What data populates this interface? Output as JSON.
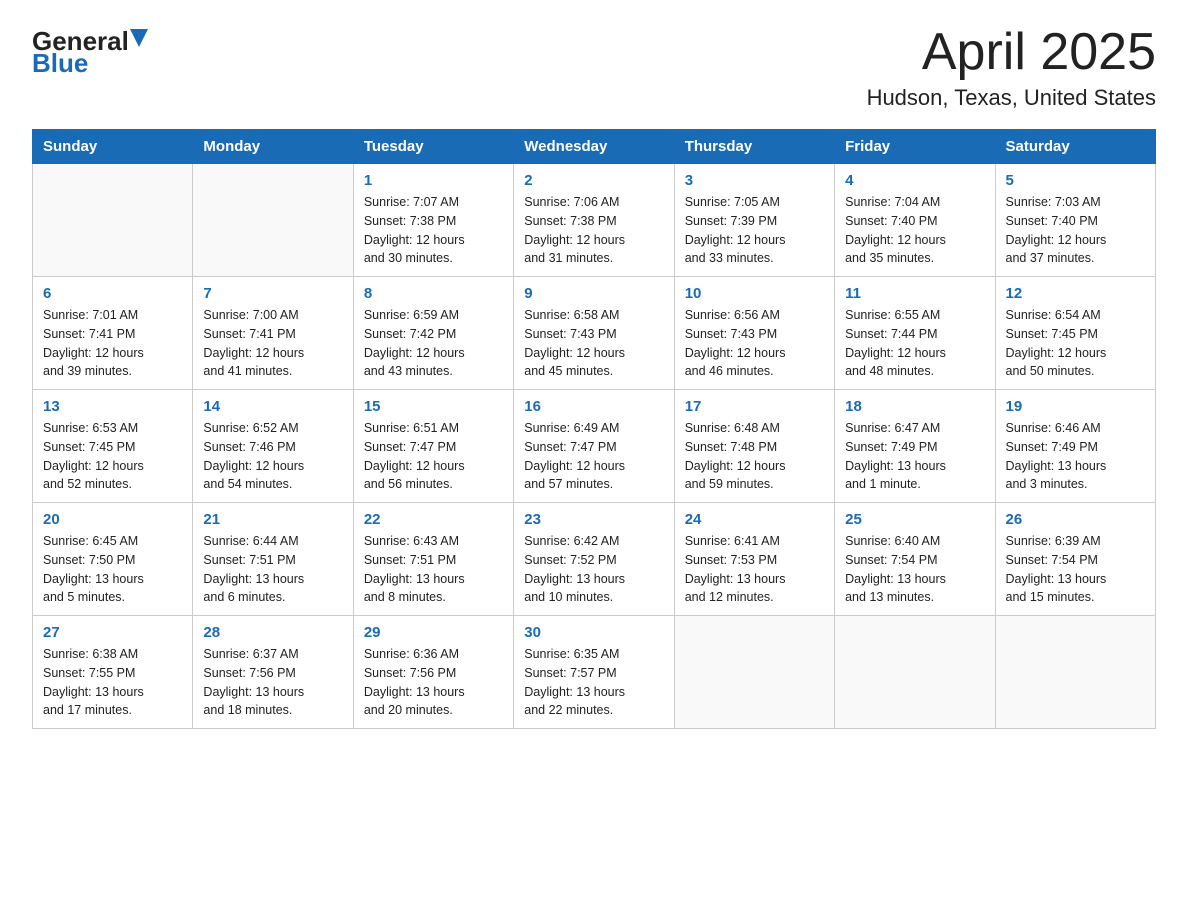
{
  "header": {
    "logo_general": "General",
    "logo_blue": "Blue",
    "title": "April 2025",
    "subtitle": "Hudson, Texas, United States"
  },
  "days_of_week": [
    "Sunday",
    "Monday",
    "Tuesday",
    "Wednesday",
    "Thursday",
    "Friday",
    "Saturday"
  ],
  "weeks": [
    [
      {
        "day": "",
        "info": ""
      },
      {
        "day": "",
        "info": ""
      },
      {
        "day": "1",
        "info": "Sunrise: 7:07 AM\nSunset: 7:38 PM\nDaylight: 12 hours\nand 30 minutes."
      },
      {
        "day": "2",
        "info": "Sunrise: 7:06 AM\nSunset: 7:38 PM\nDaylight: 12 hours\nand 31 minutes."
      },
      {
        "day": "3",
        "info": "Sunrise: 7:05 AM\nSunset: 7:39 PM\nDaylight: 12 hours\nand 33 minutes."
      },
      {
        "day": "4",
        "info": "Sunrise: 7:04 AM\nSunset: 7:40 PM\nDaylight: 12 hours\nand 35 minutes."
      },
      {
        "day": "5",
        "info": "Sunrise: 7:03 AM\nSunset: 7:40 PM\nDaylight: 12 hours\nand 37 minutes."
      }
    ],
    [
      {
        "day": "6",
        "info": "Sunrise: 7:01 AM\nSunset: 7:41 PM\nDaylight: 12 hours\nand 39 minutes."
      },
      {
        "day": "7",
        "info": "Sunrise: 7:00 AM\nSunset: 7:41 PM\nDaylight: 12 hours\nand 41 minutes."
      },
      {
        "day": "8",
        "info": "Sunrise: 6:59 AM\nSunset: 7:42 PM\nDaylight: 12 hours\nand 43 minutes."
      },
      {
        "day": "9",
        "info": "Sunrise: 6:58 AM\nSunset: 7:43 PM\nDaylight: 12 hours\nand 45 minutes."
      },
      {
        "day": "10",
        "info": "Sunrise: 6:56 AM\nSunset: 7:43 PM\nDaylight: 12 hours\nand 46 minutes."
      },
      {
        "day": "11",
        "info": "Sunrise: 6:55 AM\nSunset: 7:44 PM\nDaylight: 12 hours\nand 48 minutes."
      },
      {
        "day": "12",
        "info": "Sunrise: 6:54 AM\nSunset: 7:45 PM\nDaylight: 12 hours\nand 50 minutes."
      }
    ],
    [
      {
        "day": "13",
        "info": "Sunrise: 6:53 AM\nSunset: 7:45 PM\nDaylight: 12 hours\nand 52 minutes."
      },
      {
        "day": "14",
        "info": "Sunrise: 6:52 AM\nSunset: 7:46 PM\nDaylight: 12 hours\nand 54 minutes."
      },
      {
        "day": "15",
        "info": "Sunrise: 6:51 AM\nSunset: 7:47 PM\nDaylight: 12 hours\nand 56 minutes."
      },
      {
        "day": "16",
        "info": "Sunrise: 6:49 AM\nSunset: 7:47 PM\nDaylight: 12 hours\nand 57 minutes."
      },
      {
        "day": "17",
        "info": "Sunrise: 6:48 AM\nSunset: 7:48 PM\nDaylight: 12 hours\nand 59 minutes."
      },
      {
        "day": "18",
        "info": "Sunrise: 6:47 AM\nSunset: 7:49 PM\nDaylight: 13 hours\nand 1 minute."
      },
      {
        "day": "19",
        "info": "Sunrise: 6:46 AM\nSunset: 7:49 PM\nDaylight: 13 hours\nand 3 minutes."
      }
    ],
    [
      {
        "day": "20",
        "info": "Sunrise: 6:45 AM\nSunset: 7:50 PM\nDaylight: 13 hours\nand 5 minutes."
      },
      {
        "day": "21",
        "info": "Sunrise: 6:44 AM\nSunset: 7:51 PM\nDaylight: 13 hours\nand 6 minutes."
      },
      {
        "day": "22",
        "info": "Sunrise: 6:43 AM\nSunset: 7:51 PM\nDaylight: 13 hours\nand 8 minutes."
      },
      {
        "day": "23",
        "info": "Sunrise: 6:42 AM\nSunset: 7:52 PM\nDaylight: 13 hours\nand 10 minutes."
      },
      {
        "day": "24",
        "info": "Sunrise: 6:41 AM\nSunset: 7:53 PM\nDaylight: 13 hours\nand 12 minutes."
      },
      {
        "day": "25",
        "info": "Sunrise: 6:40 AM\nSunset: 7:54 PM\nDaylight: 13 hours\nand 13 minutes."
      },
      {
        "day": "26",
        "info": "Sunrise: 6:39 AM\nSunset: 7:54 PM\nDaylight: 13 hours\nand 15 minutes."
      }
    ],
    [
      {
        "day": "27",
        "info": "Sunrise: 6:38 AM\nSunset: 7:55 PM\nDaylight: 13 hours\nand 17 minutes."
      },
      {
        "day": "28",
        "info": "Sunrise: 6:37 AM\nSunset: 7:56 PM\nDaylight: 13 hours\nand 18 minutes."
      },
      {
        "day": "29",
        "info": "Sunrise: 6:36 AM\nSunset: 7:56 PM\nDaylight: 13 hours\nand 20 minutes."
      },
      {
        "day": "30",
        "info": "Sunrise: 6:35 AM\nSunset: 7:57 PM\nDaylight: 13 hours\nand 22 minutes."
      },
      {
        "day": "",
        "info": ""
      },
      {
        "day": "",
        "info": ""
      },
      {
        "day": "",
        "info": ""
      }
    ]
  ]
}
